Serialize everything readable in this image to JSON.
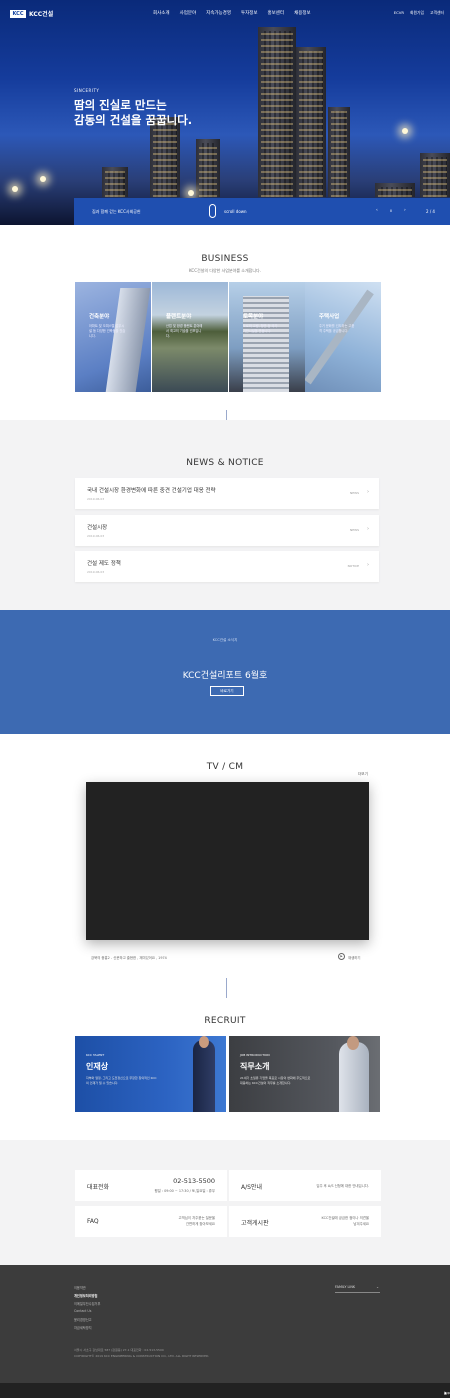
{
  "header": {
    "logo_mark": "KCC",
    "logo_text": "KCC건설",
    "nav": [
      "회사소개",
      "사업분야",
      "지속가능경영",
      "투자정보",
      "홍보센터",
      "채용정보"
    ],
    "util": [
      "ECVR",
      "회원가입",
      "고객센터"
    ]
  },
  "hero": {
    "tag": "SINCERITY",
    "headline_1": "땀의 진실로 만드는",
    "headline_2": "감동의 건설을 꿈꿉니다.",
    "bar_label": "집과 함께 걷는 KCC사회공헌",
    "scroll_label": "scroll down",
    "prev": "‹",
    "pause": "Ⅱ",
    "next": "›",
    "page": "2 / 4"
  },
  "business": {
    "title": "BUSINESS",
    "subtitle": "KCC건설의 다양한 사업분야를 소개합니다.",
    "cards": [
      {
        "title": "건축분야",
        "desc": "아파트 및 오피스텔 업무시설 등 다양한 건축물을 짓습니다.",
        "bg": "#7f9fd6"
      },
      {
        "title": "플랜트분야",
        "desc": "산업 및 환경 플랜트 분야에서 최고의 기술을 선보입니다.",
        "bg": "#6b7d5a"
      },
      {
        "title": "토목분야",
        "desc": "도로와 교량, 항만 등 국가 기반시설을 만듭니다.",
        "bg": "#8fa8c8"
      },
      {
        "title": "주택사업",
        "desc": "주거 문화를 선도하는 고품격 주택을 공급합니다.",
        "bg": "#a6c0de"
      }
    ]
  },
  "news": {
    "title": "NEWS & NOTICE",
    "items": [
      {
        "headline": "국내 건설시장 환경변화에 따른 중견 건설기업 대응 전략",
        "date": "2019.06.03",
        "category": "NEWS"
      },
      {
        "headline": "건설시장",
        "date": "2019.06.03",
        "category": "NEWS"
      },
      {
        "headline": "건설 제도 정책",
        "date": "2019.06.03",
        "category": "NOTICE"
      }
    ]
  },
  "report": {
    "kicker": "KCC건설 소식지",
    "title": "KCC건설리포트 6월호",
    "button": "바로가기"
  },
  "tv": {
    "title": "TV / CM",
    "more": "더보기",
    "caption": "강북의 중흥2 - 신문하고 출현한 , 재미있어요 , 1974",
    "play_label": "재생하기"
  },
  "recruit": {
    "title": "RECRUIT",
    "cards": [
      {
        "tag": "KCC TALENT",
        "title": "인재상",
        "desc": "자부와 열정, 그리고 도전정신으로 무장한 창의적인 KCC의 인재가 될 수 있습니다."
      },
      {
        "tag": "JOB INTRODUCTION",
        "title": "직무소개",
        "desc": "21세기 초일류 기업을 목표로 시장의 변화에 주도적으로 대응하는 KCC건설의 직무를 소개합니다."
      }
    ]
  },
  "contact": {
    "boxes": [
      {
        "key": "대표전화",
        "value": "02-513-5500",
        "sub": "평일 : 09:00 ~ 17:30 / 토,일요일 : 휴무"
      },
      {
        "key": "A/S안내",
        "value": "입주 후 A/S 신청에 대한 안내입니다."
      },
      {
        "key": "FAQ",
        "value": "고객님이 자주묻는 질문을",
        "sub": "간편하게 찾아보세요"
      },
      {
        "key": "고객게시판",
        "value": "KCC건설에 궁금한 점이나 의견을",
        "sub": "남겨주세요"
      }
    ]
  },
  "footer": {
    "links": [
      "이용약관",
      "개인정보처리방침",
      "이메일무단수집거부",
      "Contact Us",
      "윤리경영신고",
      "자금세탁방지"
    ],
    "family_link": "FAMILY LINK",
    "address": "서울시 서초구 강남대로 587 (잠원동) 27-1 대표전화 : 02-513-5500",
    "copyright": "COPYRIGHT© 2019 KCC ENGINEERING & CONSTRUCTION CO., LTD. ALL RIGHT RESERVED.",
    "top": "top"
  },
  "colors": {
    "brand": "#1f4fb0",
    "report_bg": "#3d6ab2"
  }
}
